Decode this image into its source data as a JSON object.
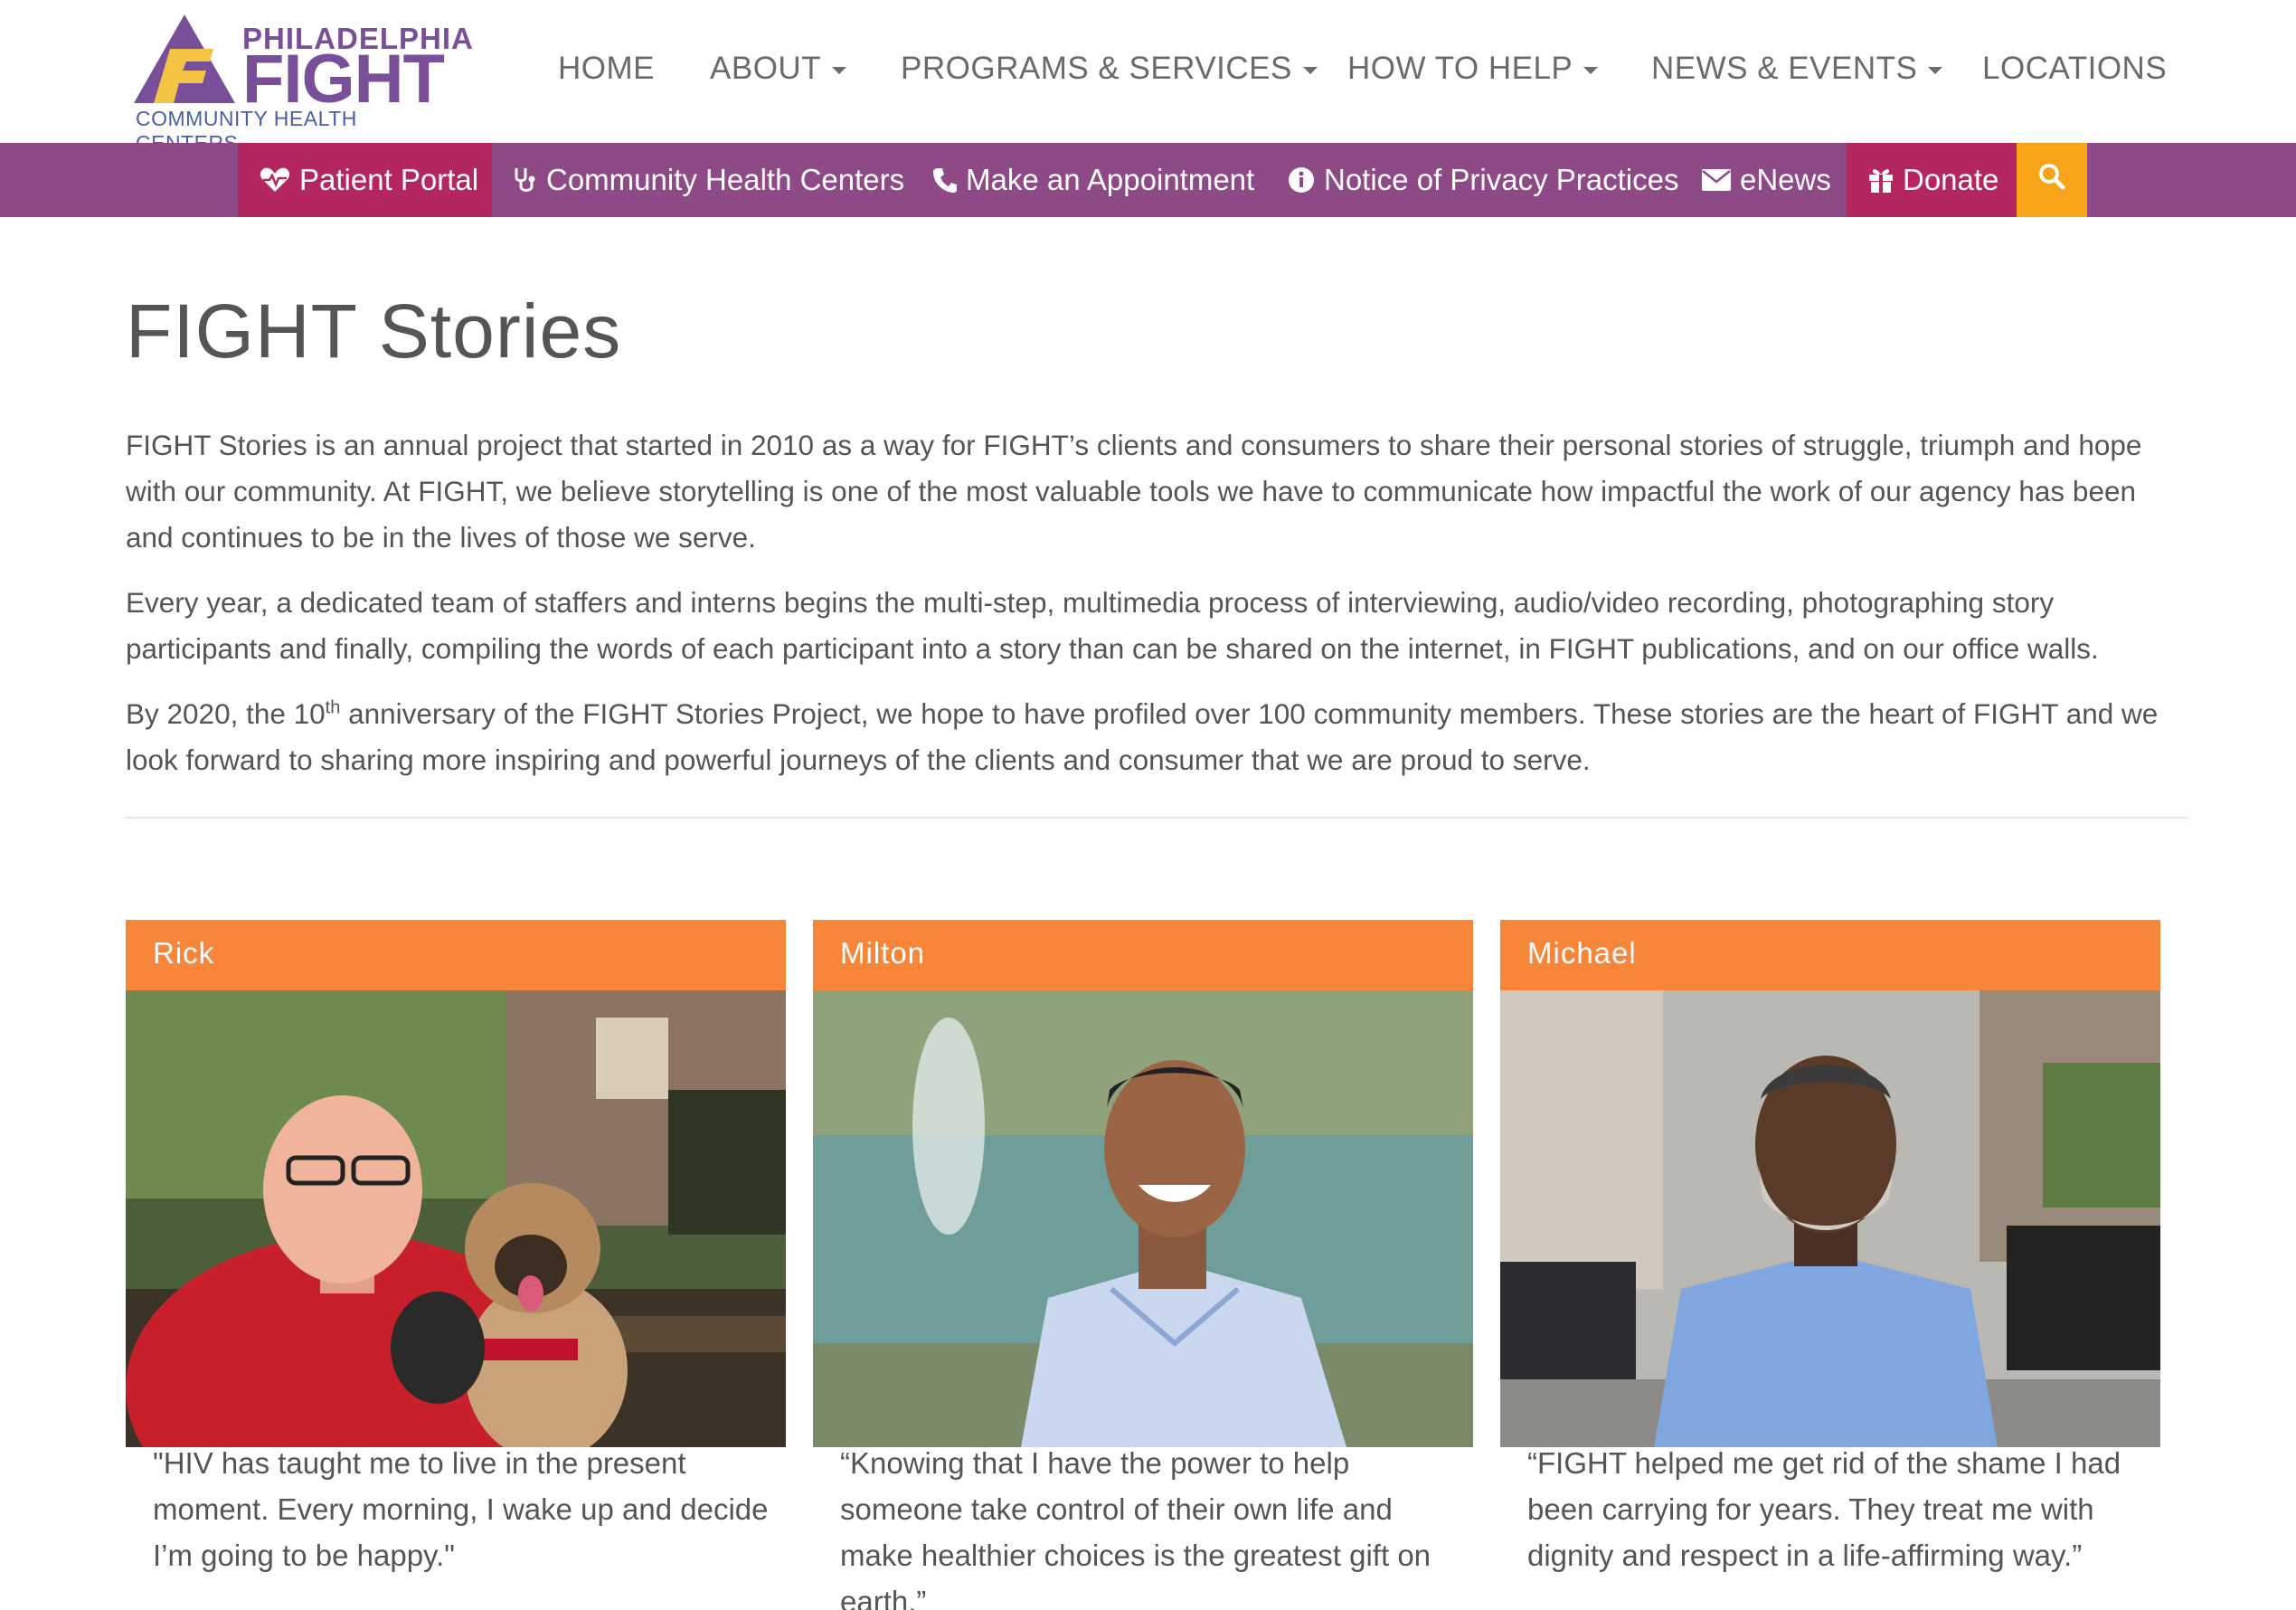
{
  "logo": {
    "line1": "PHILADELPHIA",
    "line2": "FIGHT",
    "line3": "COMMUNITY HEALTH CENTERS",
    "colors": {
      "purple": "#7a4f9a",
      "gold": "#f3c443",
      "blue": "#4a5fa8"
    }
  },
  "nav": {
    "home": "HOME",
    "about": "ABOUT",
    "programs": "PROGRAMS & SERVICES",
    "how_to_help": "HOW TO HELP",
    "news": "NEWS & EVENTS",
    "locations": "LOCATIONS"
  },
  "utility": {
    "patient_portal": "Patient Portal",
    "health_centers": "Community Health Centers",
    "appointment": "Make an Appointment",
    "privacy": "Notice of Privacy Practices",
    "enews": "eNews",
    "donate": "Donate",
    "colors": {
      "bar": "#8e4a86",
      "pink": "#b3265f",
      "search": "#f8a318"
    }
  },
  "page": {
    "title": "FIGHT Stories",
    "p1": "FIGHT Stories is an annual project that started in 2010 as a way for FIGHT’s clients and consumers to share their personal stories of struggle, triumph and hope with our community. At FIGHT, we believe storytelling is one of the most valuable tools we have to communicate how impactful the work of our agency has been and continues to be in the lives of those we serve.",
    "p2": "Every year, a dedicated team of staffers and interns begins the multi-step, multimedia process of interviewing, audio/video recording, photographing story participants and finally, compiling the words of each participant into a story than can be shared on the internet, in FIGHT publications, and on our office walls.",
    "p3_a": "By 2020, the 10",
    "p3_sup": "th",
    "p3_b": " anniversary of the FIGHT Stories Project, we hope to have profiled over 100 community members.  These stories are the heart of FIGHT and we look forward to sharing more inspiring and powerful journeys of the clients and consumer that we are proud to serve."
  },
  "stories": [
    {
      "name": "Rick",
      "quote": "\"HIV has taught me to live in the present moment. Every morning, I wake up and decide I’m going to be happy.\""
    },
    {
      "name": "Milton",
      "quote": "“Knowing that I have the power to help someone take control of their own life and make healthier choices is the greatest gift on earth.”"
    },
    {
      "name": "Michael",
      "quote": "“FIGHT helped me get rid of the shame I had been carrying for years. They treat me with dignity and respect in a life-affirming way.”"
    }
  ],
  "card_color": "#f7863a"
}
